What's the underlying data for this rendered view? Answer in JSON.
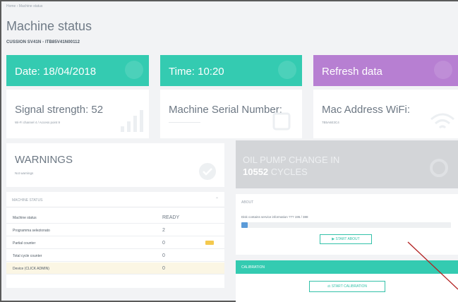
{
  "header": {
    "breadcrumb": "Home › Machine status",
    "title": "Machine status",
    "subtitle": "CUSSION SV41N - ITB85V41N00112"
  },
  "tiles": {
    "date": "Date: 18/04/2018",
    "time": "Time: 10:20",
    "refresh": "Refresh data"
  },
  "cards": {
    "signal_title": "Signal strength: 52",
    "signal_sub": "Wi-Fi channel 4 / Access point 9",
    "serial_title": "Machine Serial Number:",
    "serial_value": "——————————",
    "mac_title": "Mac Address WiFi:",
    "mac_value": "7B5A6E3C4"
  },
  "warnings": {
    "title": "WARNINGS",
    "sub": "Not warnings"
  },
  "oil": {
    "line1": "OIL PUMP CHANGE IN",
    "cycles": "10552",
    "cycles_suffix": " CYCLES"
  },
  "machine_status": {
    "header": "MACHINE STATUS",
    "rows": [
      {
        "label": "Machine status",
        "value": "READY"
      },
      {
        "label": "Programma selezionato",
        "value": "2"
      },
      {
        "label": "Partial counter",
        "value": "0"
      },
      {
        "label": "Total cycle counter",
        "value": "0"
      },
      {
        "label": "Device (CLICK ADMIN)",
        "value": "0"
      }
    ]
  },
  "about": {
    "header": "ABOUT",
    "line": "Disk contains service information ??? 195 / 388",
    "progress": 0.03,
    "button": "▶ START ABOUT"
  },
  "calibration": {
    "header": "CALIBRATION",
    "button": "⚖ START CALIBRATION"
  },
  "colors": {
    "teal": "#34cbb1",
    "purple": "#b77fd2",
    "grey_card": "#d3d5d8",
    "annotation": "#b22222"
  }
}
